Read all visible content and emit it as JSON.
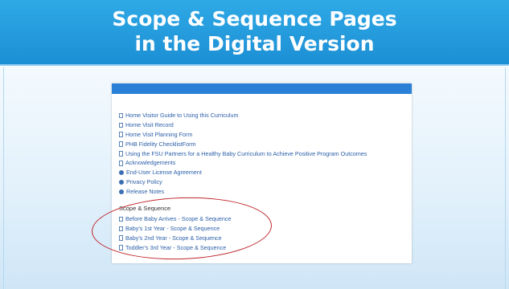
{
  "slide": {
    "title_line1": "Scope & Sequence Pages",
    "title_line2": "in the Digital Version"
  },
  "links": [
    {
      "label": "Home Visitor Guide to Using this Curriculum",
      "icon": "document-icon"
    },
    {
      "label": "Home Visit Record",
      "icon": "document-icon"
    },
    {
      "label": "Home Visit Planning Form",
      "icon": "document-icon"
    },
    {
      "label": "PHB Fidelity ChecklistForm",
      "icon": "document-icon"
    },
    {
      "label": "Using the FSU Partners for a Healthy Baby Curriculum to Achieve Positive Program Outcomes",
      "icon": "document-icon"
    },
    {
      "label": "Acknowledgements",
      "icon": "document-icon"
    },
    {
      "label": "End-User License Agreement",
      "icon": "globe-icon"
    },
    {
      "label": "Privacy Policy",
      "icon": "globe-icon"
    },
    {
      "label": "Release Notes",
      "icon": "globe-icon"
    }
  ],
  "scope_section": {
    "heading": "Scope & Sequence",
    "items": [
      "Before Baby Arrives - Scope & Sequence",
      "Baby's 1st Year - Scope & Sequence",
      "Baby's 2nd Year - Scope & Sequence",
      "Toddler's 3rd Year - Scope & Sequence"
    ]
  },
  "colors": {
    "title_band": "#1c8fd4",
    "screenshot_header": "#2a7fd6",
    "link_text": "#2b5fa8",
    "annotation_circle": "#c0262c"
  }
}
